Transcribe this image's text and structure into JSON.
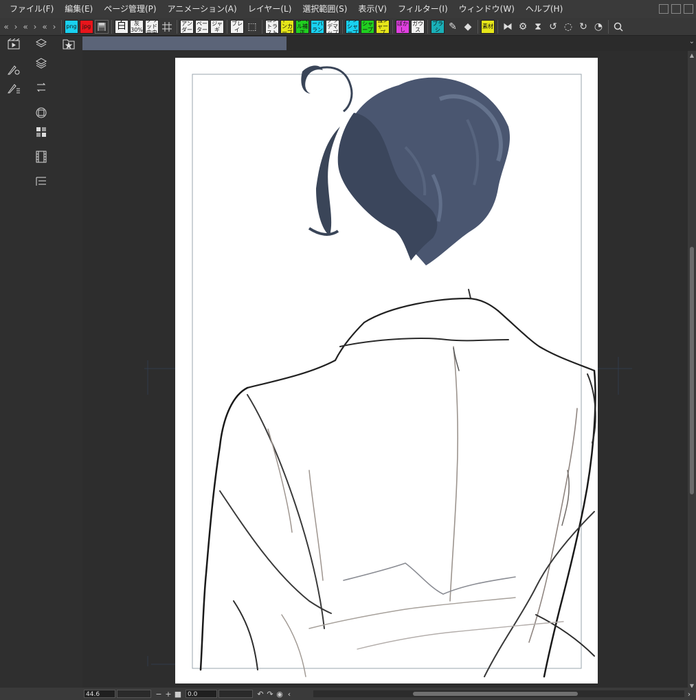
{
  "menu": [
    "ファイル(F)",
    "編集(E)",
    "ページ管理(P)",
    "アニメーション(A)",
    "レイヤー(L)",
    "選択範囲(S)",
    "表示(V)",
    "フィルター(I)",
    "ウィンドウ(W)",
    "ヘルプ(H)"
  ],
  "toolbar": {
    "nav_left": "«",
    "nav_left2": "›",
    "nav_left3": "«",
    "nav_right": "›",
    "nav_right2": "«",
    "nav_right3": "›",
    "buttons": [
      {
        "label": "png",
        "color": "#19d1f0"
      },
      {
        "label": "jpg",
        "color": "#e8151b"
      },
      {
        "label": "白",
        "color": "#f2f2f2"
      },
      {
        "label": "灰30%",
        "color": "#f2f2f2"
      },
      {
        "label": "グリッド中央",
        "color": "#f2f2f2"
      },
      {
        "label": "",
        "color": "#f2f2f2"
      },
      {
        "label": "アンダー",
        "color": "#f2f2f2"
      },
      {
        "label": "ペーター",
        "color": "#f2f2f2"
      },
      {
        "label": "ジャギ",
        "color": "#f2f2f2"
      },
      {
        "label": "ブレイ",
        "color": "#f2f2f2"
      },
      {
        "label": "コントラスト",
        "color": "#f2f2f2"
      },
      {
        "label": "トーンカーブ",
        "color": "#e6e619"
      },
      {
        "label": "レベル補正",
        "color": "#20d020"
      },
      {
        "label": "カラーバランス",
        "color": "#19d1f0"
      },
      {
        "label": "グラデマップ",
        "color": "#f2f2f2"
      },
      {
        "label": "アンシャープ",
        "color": "#19d1f0"
      },
      {
        "label": "シャープ",
        "color": "#20d020"
      },
      {
        "label": "強シャープ",
        "color": "#e6e619"
      },
      {
        "label": "ぼかし",
        "color": "#e040e0"
      },
      {
        "label": "ガウス",
        "color": "#f2f2f2"
      },
      {
        "label": "ブラシ",
        "color": "#1ab0b8"
      },
      {
        "label": "素材",
        "color": "#e6e619"
      }
    ]
  },
  "status": {
    "zoom": "44.6",
    "rotation": "0.0"
  },
  "colors": {
    "menubar": "#3a3a3a",
    "panel": "#2f2f2f",
    "canvas_bg": "#2d2d2d",
    "page": "#ffffff",
    "hair": "#4a5670",
    "tab_active": "#5b6478"
  }
}
